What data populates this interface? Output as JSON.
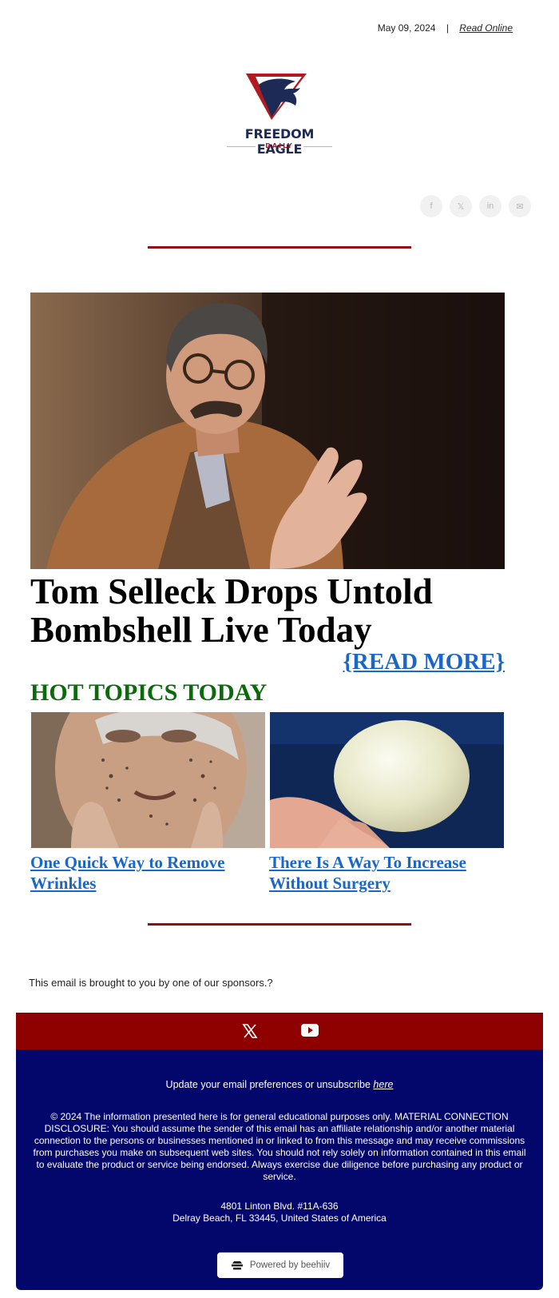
{
  "header": {
    "date": "May 09, 2024",
    "separator": "|",
    "read_online": "Read Online"
  },
  "logo": {
    "name": "FREEDOM EAGLE",
    "tagline": "DAILY"
  },
  "social": {
    "icons": [
      {
        "name": "facebook-icon",
        "glyph": "f"
      },
      {
        "name": "x-icon",
        "glyph": "𝕏"
      },
      {
        "name": "linkedin-icon",
        "glyph": "in"
      },
      {
        "name": "email-icon",
        "glyph": "✉"
      }
    ]
  },
  "hero": {
    "title": "Tom Selleck Drops Untold Bombshell Live Today",
    "read_more": "{READ MORE}"
  },
  "hot_topics": {
    "title": "HOT TOPICS TODAY",
    "items": [
      {
        "label": "One Quick Way to Remove Wrinkles"
      },
      {
        "label": "There Is A Way To Increase Without Surgery"
      }
    ]
  },
  "sponsor_text": "This email is brought to you by one of our sponsors.?",
  "footer": {
    "prefs_text": "Update your email preferences or unsubscribe",
    "prefs_link": "here",
    "disclaimer": "© 2024 The information presented here is for general educational purposes only. MATERIAL CONNECTION DISCLOSURE: You should assume the sender of this email has an affiliate relationship and/or another material connection to the persons or businesses mentioned in or linked to from this message and may receive commissions from purchases you make on subsequent web sites. You should not rely solely on information contained in this email to evaluate the product or service being endorsed. Always exercise due diligence before purchasing any product or service.",
    "address_line1": "4801 Linton Blvd. #11A-636",
    "address_line2": "Delray Beach, FL 33445, United States of America",
    "powered_by": "Powered by beehiiv"
  },
  "colors": {
    "accent_red": "#8f0000",
    "footer_navy": "#03066b",
    "link_blue": "#1a67c8",
    "hot_green": "#0a6b0a"
  }
}
